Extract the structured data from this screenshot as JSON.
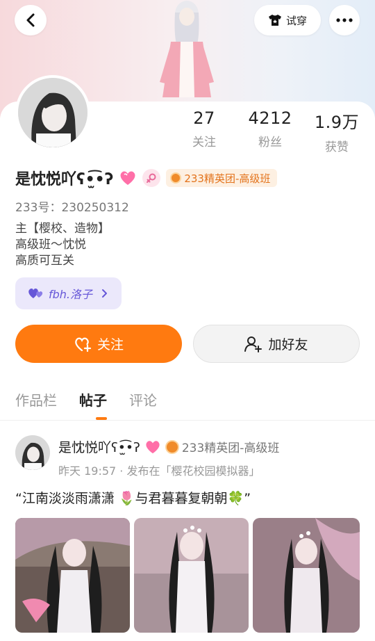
{
  "header": {
    "tryon_label": "试穿"
  },
  "profile": {
    "name": "是忱悦吖ʕ•̫͡•ʔ",
    "group_badge": "233精英团-高级班",
    "id_line": "233号：230250312",
    "bio": [
      "主【樱校、造物】",
      "高级班～忱悦",
      "高质可互关"
    ],
    "tag_pill": "fbh.洛子",
    "stats": [
      {
        "value": "27",
        "label": "关注"
      },
      {
        "value": "4212",
        "label": "粉丝"
      },
      {
        "value": "1.9万",
        "label": "获赞"
      }
    ]
  },
  "actions": {
    "follow_label": "关注",
    "add_friend_label": "加好友"
  },
  "tabs": [
    {
      "label": "作品栏",
      "active": false
    },
    {
      "label": "帖子",
      "active": true
    },
    {
      "label": "评论",
      "active": false
    }
  ],
  "post": {
    "author": "是忱悦吖ʕ•̫͡•ʔ",
    "group": "233精英团-高级班",
    "meta": "昨天 19:57 · 发布在「樱花校园模拟器」",
    "text": "“江南淡淡雨潇潇 🌷与君暮暮复朝朝🍀”"
  },
  "colors": {
    "accent": "#ff7a10",
    "badge_text": "#e3731c",
    "tag_purple": "#6657d8"
  }
}
